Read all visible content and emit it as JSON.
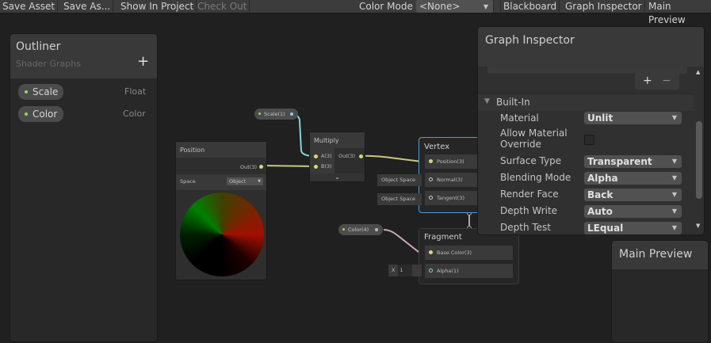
{
  "toolbar": {
    "save_asset": "Save Asset",
    "save_as": "Save As...",
    "show_in_project": "Show In Project",
    "check_out": "Check Out",
    "color_mode_label": "Color Mode",
    "color_mode_value": "<None>",
    "blackboard": "Blackboard",
    "graph_inspector": "Graph Inspector",
    "main_preview": "Main Preview"
  },
  "outliner": {
    "title": "Outliner",
    "subtitle": "Shader Graphs",
    "add": "+",
    "properties": [
      {
        "name": "Scale",
        "type": "Float"
      },
      {
        "name": "Color",
        "type": "Color"
      }
    ]
  },
  "inspector": {
    "title": "Graph Inspector",
    "add": "+",
    "remove": "−",
    "section": "Built-In",
    "fields": [
      {
        "label": "Material",
        "value": "Unlit"
      },
      {
        "label": "Allow Material Override",
        "value": ""
      },
      {
        "label": "Surface Type",
        "value": "Transparent"
      },
      {
        "label": "Blending Mode",
        "value": "Alpha"
      },
      {
        "label": "Render Face",
        "value": "Back"
      },
      {
        "label": "Depth Write",
        "value": "Auto"
      },
      {
        "label": "Depth Test",
        "value": "LEqual"
      }
    ]
  },
  "preview": {
    "title": "Main Preview"
  },
  "graph": {
    "scale_prop": "Scale(1)",
    "color_prop": "Color(4)",
    "multiply": {
      "title": "Multiply",
      "a": "A(3)",
      "b": "B(3)",
      "out": "Out(3)"
    },
    "position": {
      "title": "Position",
      "out": "Out(3)",
      "space_label": "Space",
      "space_value": "Object"
    },
    "vertex": {
      "title": "Vertex",
      "position": "Position(3)",
      "normal": "Normal(3)",
      "tangent": "Tangent(3)",
      "normal_default": "Object Space",
      "tangent_default": "Object Space"
    },
    "fragment": {
      "title": "Fragment",
      "base_color": "Base Color(3)",
      "alpha": "Alpha(1)",
      "alpha_x": "X",
      "alpha_value": "1"
    }
  },
  "colors": {
    "vector3_wire": "#c8c882",
    "float_wire": "#84d4e0",
    "color_wire": "#d4a8d4",
    "selection": "#4a9fd8"
  }
}
